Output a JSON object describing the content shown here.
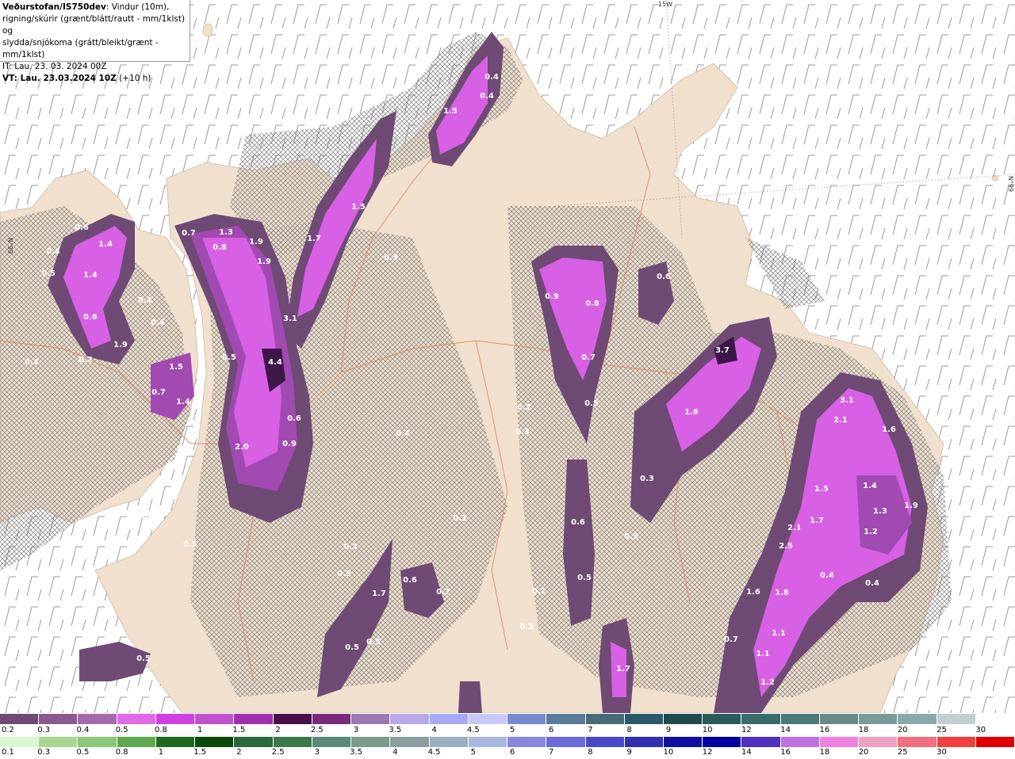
{
  "header": {
    "source": "Veðurstofan/IS750dev",
    "desc_1": ": Vindur (10m),",
    "desc_2": "rigning/skúrir (grænt/blátt/rautt - mm/1klst) og",
    "desc_3": "slydda/snjókoma (grátt/bleikt/grænt - mm/1klst)",
    "it_line": "IT: Lau. 23. 03. 2024 00Z",
    "vt_bold": "VT: Lau. 23.03.2024 10Z",
    "vt_offset": " (+10 h)"
  },
  "grid_labels": {
    "lon": "15W",
    "lat_left": "N°99",
    "lat_right": "N°99"
  },
  "colors": {
    "land": "#f1e0cd",
    "sea": "#ffffff",
    "road": "#e2835b",
    "hatch": "#7d7d7d",
    "snow_dark": "#6e4a74",
    "snow_mid": "#a14ab1",
    "snow_light": "#d860e4",
    "snow_peak": "#3c1747"
  },
  "precip_labels": [
    {
      "v": "0.4"
    },
    {
      "v": "0.4"
    },
    {
      "v": "1.5"
    },
    {
      "v": "1.5"
    },
    {
      "v": "1.7"
    },
    {
      "v": "0.3"
    },
    {
      "v": "1.9"
    },
    {
      "v": "1.9"
    },
    {
      "v": "0.8"
    },
    {
      "v": "1.3"
    },
    {
      "v": "0.7"
    },
    {
      "v": "3.1"
    },
    {
      "v": "4.4"
    },
    {
      "v": "0.5"
    },
    {
      "v": "0.6"
    },
    {
      "v": "0.9"
    },
    {
      "v": "2.0"
    },
    {
      "v": "0.6"
    },
    {
      "v": "1.4"
    },
    {
      "v": "0.4"
    },
    {
      "v": "0.5"
    },
    {
      "v": "1.4"
    },
    {
      "v": "0.6"
    },
    {
      "v": "0.4"
    },
    {
      "v": "0.4"
    },
    {
      "v": "1.9"
    },
    {
      "v": "1.5"
    },
    {
      "v": "0.7"
    },
    {
      "v": "1.4"
    },
    {
      "v": "0.4"
    },
    {
      "v": "0.2"
    },
    {
      "v": "0.3"
    },
    {
      "v": "0.9"
    },
    {
      "v": "0.8"
    },
    {
      "v": "0.6"
    },
    {
      "v": "0.7"
    },
    {
      "v": "0.5"
    },
    {
      "v": "0.4"
    },
    {
      "v": "0.2"
    },
    {
      "v": "0.3"
    },
    {
      "v": "3.7"
    },
    {
      "v": "1.6"
    },
    {
      "v": "0.3"
    },
    {
      "v": "3.1"
    },
    {
      "v": "2.1"
    },
    {
      "v": "1.6"
    },
    {
      "v": "1.5"
    },
    {
      "v": "1.4"
    },
    {
      "v": "1.9"
    },
    {
      "v": "1.3"
    },
    {
      "v": "1.7"
    },
    {
      "v": "2.1"
    },
    {
      "v": "1.2"
    },
    {
      "v": "2.5"
    },
    {
      "v": "1.8"
    },
    {
      "v": "1.6"
    },
    {
      "v": "0.4"
    },
    {
      "v": "0.4"
    },
    {
      "v": "1.1"
    },
    {
      "v": "0.7"
    },
    {
      "v": "1.1"
    },
    {
      "v": "1.2"
    },
    {
      "v": "0.6"
    },
    {
      "v": "0.3"
    },
    {
      "v": "0.5"
    },
    {
      "v": "0.2"
    },
    {
      "v": "0.3"
    },
    {
      "v": "1.7"
    },
    {
      "v": "0.6"
    },
    {
      "v": "0.7"
    },
    {
      "v": "0.3"
    },
    {
      "v": "1.7"
    },
    {
      "v": "0.5"
    },
    {
      "v": "0.5"
    },
    {
      "v": "0.5"
    },
    {
      "v": "0.3"
    },
    {
      "v": "0.3"
    },
    {
      "v": "0.5"
    }
  ],
  "scale_top": {
    "labels": [
      "0.2",
      "0.3",
      "0.4",
      "0.5",
      "0.8",
      "1",
      "1.5",
      "2",
      "2.5",
      "3",
      "3.5",
      "4",
      "4.5",
      "5",
      "6",
      "7",
      "8",
      "9",
      "10",
      "12",
      "14",
      "16",
      "18",
      "20",
      "25",
      "30"
    ],
    "colors": [
      "#6e4a74",
      "#8a5a8e",
      "#a56aab",
      "#e06ae8",
      "#d040e0",
      "#c050d0",
      "#a030b0",
      "#4a0f4a",
      "#7a2a7a",
      "#9a7ab0",
      "#b8a8e8",
      "#a8a8f8",
      "#c8c8ff",
      "#7a8ad0",
      "#5a7a9a",
      "#4a6a7a",
      "#2a5a6a",
      "#1f4a50",
      "#2a5a5a",
      "#3a6a6a",
      "#4a7a7a",
      "#6a8a8a",
      "#7a9a9a",
      "#8aaaaa",
      "#c0d0d0",
      "#ffffff"
    ]
  },
  "scale_bottom": {
    "labels": [
      "0.1",
      "0.3",
      "0.5",
      "0.8",
      "1",
      "1.5",
      "2",
      "2.5",
      "3",
      "3.5",
      "4",
      "4.5",
      "5",
      "6",
      "7",
      "8",
      "9",
      "10",
      "12",
      "14",
      "16",
      "18",
      "20",
      "25",
      "30"
    ],
    "colors": [
      "#d8f8d0",
      "#a8d890",
      "#88c878",
      "#60a850",
      "#1f6a1f",
      "#0a4a0a",
      "#2a6a3a",
      "#3a7a4a",
      "#5a8a7a",
      "#7a9a8a",
      "#8aa0a0",
      "#9ab0c0",
      "#a8b8e0",
      "#8888e0",
      "#6a6ad8",
      "#4a4ac8",
      "#3030b0",
      "#1010a0",
      "#0000a0",
      "#5030c0",
      "#c070e0",
      "#f080e0",
      "#f0a0c0",
      "#f07080",
      "#f04040",
      "#e00000"
    ]
  }
}
